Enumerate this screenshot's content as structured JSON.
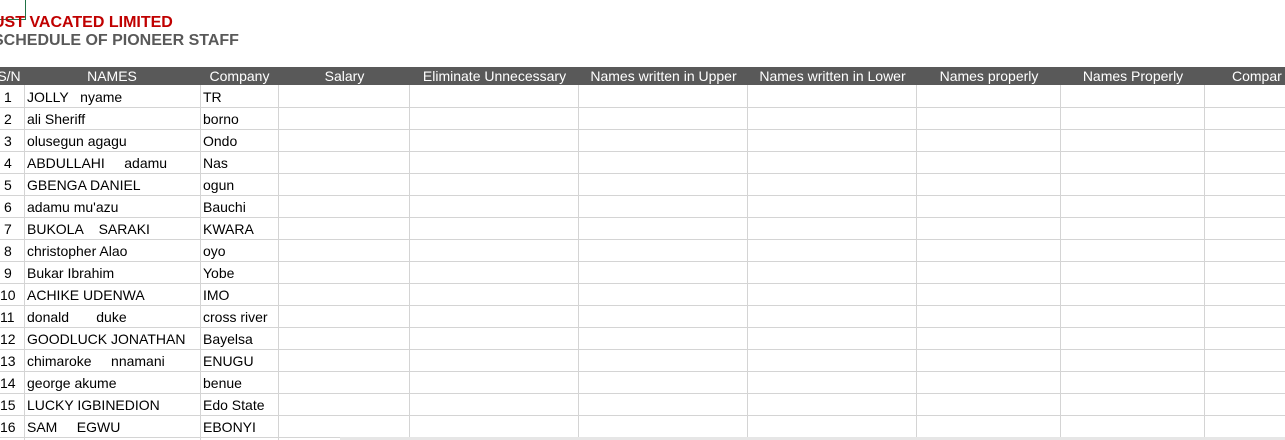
{
  "title": "UST VACATED LIMITED",
  "subtitle": "SCHEDULE OF PIONEER STAFF",
  "headers": [
    "S/N",
    "NAMES",
    "Company",
    "Salary",
    "Eliminate Unnecessary",
    "Names written in Upper",
    "Names written in Lower",
    "Names properly",
    "Names Properly",
    "Compar"
  ],
  "rows": [
    {
      "sn": "1",
      "name": "JOLLY   nyame",
      "company": "TR"
    },
    {
      "sn": "2",
      "name": "ali Sheriff",
      "company": "borno"
    },
    {
      "sn": "3",
      "name": "olusegun agagu",
      "company": "Ondo"
    },
    {
      "sn": "4",
      "name": "ABDULLAHI     adamu",
      "company": "Nas"
    },
    {
      "sn": "5",
      "name": "GBENGA DANIEL",
      "company": "ogun"
    },
    {
      "sn": "6",
      "name": "adamu mu'azu",
      "company": "Bauchi"
    },
    {
      "sn": "7",
      "name": "BUKOLA    SARAKI",
      "company": "KWARA"
    },
    {
      "sn": "8",
      "name": "christopher Alao",
      "company": "oyo"
    },
    {
      "sn": "9",
      "name": "Bukar Ibrahim",
      "company": "Yobe"
    },
    {
      "sn": "10",
      "name": "ACHIKE UDENWA",
      "company": "IMO"
    },
    {
      "sn": "11",
      "name": "donald       duke",
      "company": "cross river"
    },
    {
      "sn": "12",
      "name": "GOODLUCK JONATHAN",
      "company": "Bayelsa"
    },
    {
      "sn": "13",
      "name": "chimaroke     nnamani",
      "company": "ENUGU"
    },
    {
      "sn": "14",
      "name": "george akume",
      "company": "benue"
    },
    {
      "sn": "15",
      "name": "LUCKY IGBINEDION",
      "company": "Edo State"
    },
    {
      "sn": "16",
      "name": "SAM     EGWU",
      "company": "EBONYI"
    }
  ],
  "colors": {
    "title": "#c00000",
    "subtitle": "#595959",
    "header_bg": "#595959",
    "header_text": "#ffffff",
    "grid": "#d4d4d4"
  }
}
